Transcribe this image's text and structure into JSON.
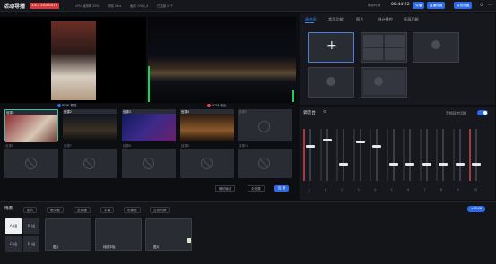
{
  "app": {
    "title": "活动导播",
    "version": "1.8.1 20200517"
  },
  "status": {
    "cpu": "CPU 使用率 29%",
    "latency": "网络 0ms",
    "quality": "画质 720p_4",
    "count": "已连接 0 个"
  },
  "time": {
    "label": "剩余时间",
    "value": "00:44:22"
  },
  "top_buttons": {
    "b1": "导播",
    "b2": "直播设置",
    "b3": "导出设置"
  },
  "preview": {
    "pvw_label": "PVW 预览",
    "pgm_label": "PGM 输出"
  },
  "sources": [
    {
      "name": "信源1",
      "audio": "1"
    },
    {
      "name": "信源2",
      "audio": "1"
    },
    {
      "name": "信源3",
      "audio": "1"
    },
    {
      "name": "信源4",
      "audio": "1"
    },
    {
      "name": "信源5",
      "audio": ""
    },
    {
      "name": "信源6",
      "audio": ""
    },
    {
      "name": "信源7",
      "audio": ""
    },
    {
      "name": "信源8",
      "audio": ""
    },
    {
      "name": "信源9",
      "audio": ""
    },
    {
      "name": "信源10",
      "audio": ""
    }
  ],
  "controls": {
    "transition": "硬切输出",
    "mode": "无效果",
    "apply": "应 用"
  },
  "right_tabs": [
    "画中画",
    "常用功能",
    "图片",
    "倒计播控",
    "拓展功能"
  ],
  "mixer": {
    "title": "调音台",
    "sync_label": "音频同步切换",
    "channels": [
      "主",
      "1",
      "2",
      "3",
      "4",
      "5",
      "6",
      "7",
      "8",
      "9",
      "10"
    ]
  },
  "scene": {
    "title": "场景",
    "buttons": [
      "图片",
      "画中画",
      "全屏播",
      "字幕",
      "布景框",
      "云台切换"
    ],
    "pvw_button": "+ PVW"
  },
  "scene_letters": [
    "A 组",
    "B 组",
    "C 组",
    "D 组"
  ],
  "cards": [
    {
      "label": "图片"
    },
    {
      "label": "纯底平板"
    },
    {
      "label": "图片"
    }
  ],
  "colors": {
    "accent": "#2f6ae6",
    "live": "#35c4a4",
    "meter": "#1fd05a"
  }
}
